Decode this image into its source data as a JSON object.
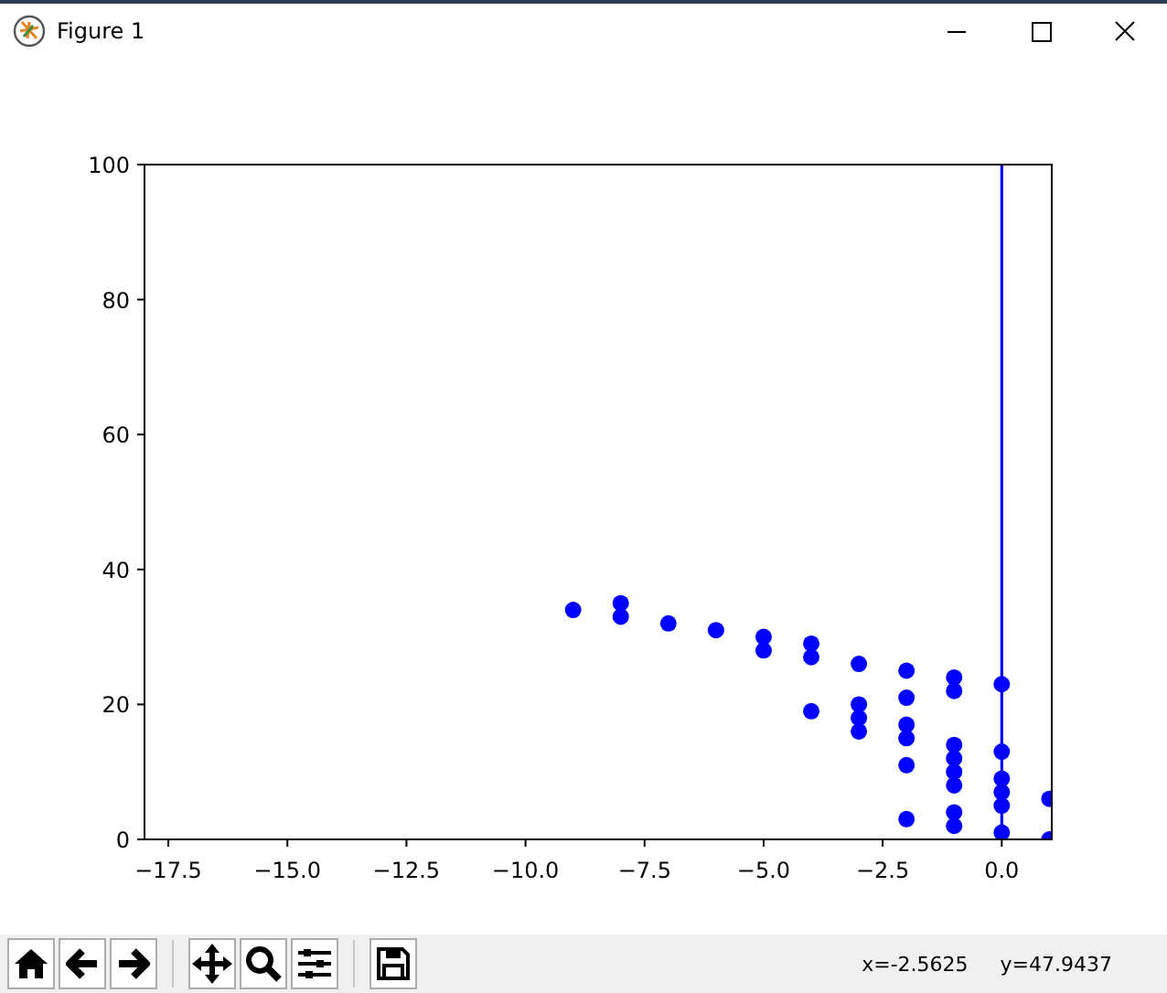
{
  "window": {
    "title": "Figure 1"
  },
  "chart_data": {
    "type": "scatter",
    "xlim": [
      -18.0,
      1.05
    ],
    "ylim": [
      0,
      100
    ],
    "xticks": [
      {
        "value": -17.5,
        "label": "−17.5"
      },
      {
        "value": -15,
        "label": "−15.0"
      },
      {
        "value": -12.5,
        "label": "−12.5"
      },
      {
        "value": -10,
        "label": "−10.0"
      },
      {
        "value": -7.5,
        "label": "−7.5"
      },
      {
        "value": -5,
        "label": "−5.0"
      },
      {
        "value": -2.5,
        "label": "−2.5"
      },
      {
        "value": 0,
        "label": "0.0"
      }
    ],
    "yticks": [
      0,
      20,
      40,
      60,
      80,
      100
    ],
    "x": [
      -9,
      -8,
      -8,
      -7,
      -6,
      -5,
      -5,
      -4,
      -4,
      -4,
      -3,
      -3,
      -3,
      -3,
      -2,
      -2,
      -2,
      -2,
      -2,
      -2,
      -1,
      -1,
      -1,
      -1,
      -1,
      -1,
      -1,
      -1,
      0,
      0,
      0,
      0,
      0,
      0,
      1,
      1
    ],
    "series": [
      {
        "color": "#0000ff",
        "values": [
          34,
          35,
          33,
          32,
          31,
          30,
          28,
          29,
          27,
          19,
          26,
          20,
          18,
          16,
          25,
          21,
          17,
          15,
          11,
          3,
          24,
          22,
          14,
          12,
          10,
          8,
          4,
          2,
          23,
          13,
          9,
          7,
          5,
          1,
          6,
          0
        ]
      }
    ],
    "ref_lines": [
      {
        "axis": "x",
        "value": 0,
        "color": "#0000ff"
      }
    ]
  },
  "toolbar": {
    "coordinates": "x=-2.5625     y=47.9437"
  }
}
